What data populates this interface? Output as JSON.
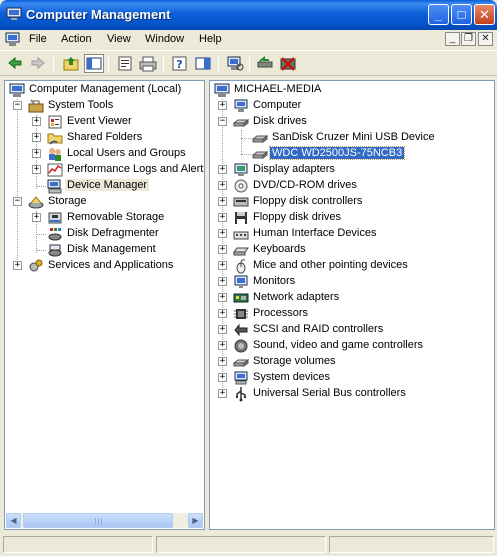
{
  "window": {
    "title": "Computer Management",
    "controls": [
      "_",
      "□",
      "✕"
    ],
    "icon": "computer-management-icon"
  },
  "menu": {
    "items": [
      "File",
      "Action",
      "View",
      "Window",
      "Help"
    ],
    "mdi_controls": [
      "_",
      "❐",
      "✕"
    ]
  },
  "toolbar": {
    "buttons": [
      "back-arrow-icon",
      "forward-arrow-icon",
      "up-folder-icon",
      "show-hide-tree-icon",
      "properties-icon",
      "print-icon",
      "help-icon",
      "show-hide-action-pane-icon",
      "scan-hardware-icon",
      "update-driver-icon",
      "disable-device-icon",
      "uninstall-device-icon"
    ]
  },
  "left_tree": {
    "root": "Computer Management (Local)",
    "groups": [
      {
        "label": "System Tools",
        "expanded": true,
        "children": [
          "Event Viewer",
          "Shared Folders",
          "Local Users and Groups",
          "Performance Logs and Alerts",
          "Device Manager"
        ]
      },
      {
        "label": "Storage",
        "expanded": true,
        "children": [
          "Removable Storage",
          "Disk Defragmenter",
          "Disk Management"
        ]
      },
      {
        "label": "Services and Applications",
        "expanded": false,
        "children": []
      }
    ],
    "selected": "Device Manager"
  },
  "device_tree": {
    "root": "MICHAEL-MEDIA",
    "categories": [
      {
        "label": "Computer",
        "expanded": false
      },
      {
        "label": "Disk drives",
        "expanded": true,
        "children": [
          "SanDisk Cruzer Mini USB Device",
          "WDC WD2500JS-75NCB3"
        ]
      },
      {
        "label": "Display adapters",
        "expanded": false
      },
      {
        "label": "DVD/CD-ROM drives",
        "expanded": false
      },
      {
        "label": "Floppy disk controllers",
        "expanded": false
      },
      {
        "label": "Floppy disk drives",
        "expanded": false
      },
      {
        "label": "Human Interface Devices",
        "expanded": false
      },
      {
        "label": "Keyboards",
        "expanded": false
      },
      {
        "label": "Mice and other pointing devices",
        "expanded": false
      },
      {
        "label": "Monitors",
        "expanded": false
      },
      {
        "label": "Network adapters",
        "expanded": false
      },
      {
        "label": "Processors",
        "expanded": false
      },
      {
        "label": "SCSI and RAID controllers",
        "expanded": false
      },
      {
        "label": "Sound, video and game controllers",
        "expanded": false
      },
      {
        "label": "Storage volumes",
        "expanded": false
      },
      {
        "label": "System devices",
        "expanded": false
      },
      {
        "label": "Universal Serial Bus controllers",
        "expanded": false
      }
    ],
    "selected": "WDC WD2500JS-75NCB3"
  },
  "colors": {
    "title_bar": "#0b5fd7",
    "selection": "#316ac5",
    "inactive_selection": "#ece9d8"
  }
}
